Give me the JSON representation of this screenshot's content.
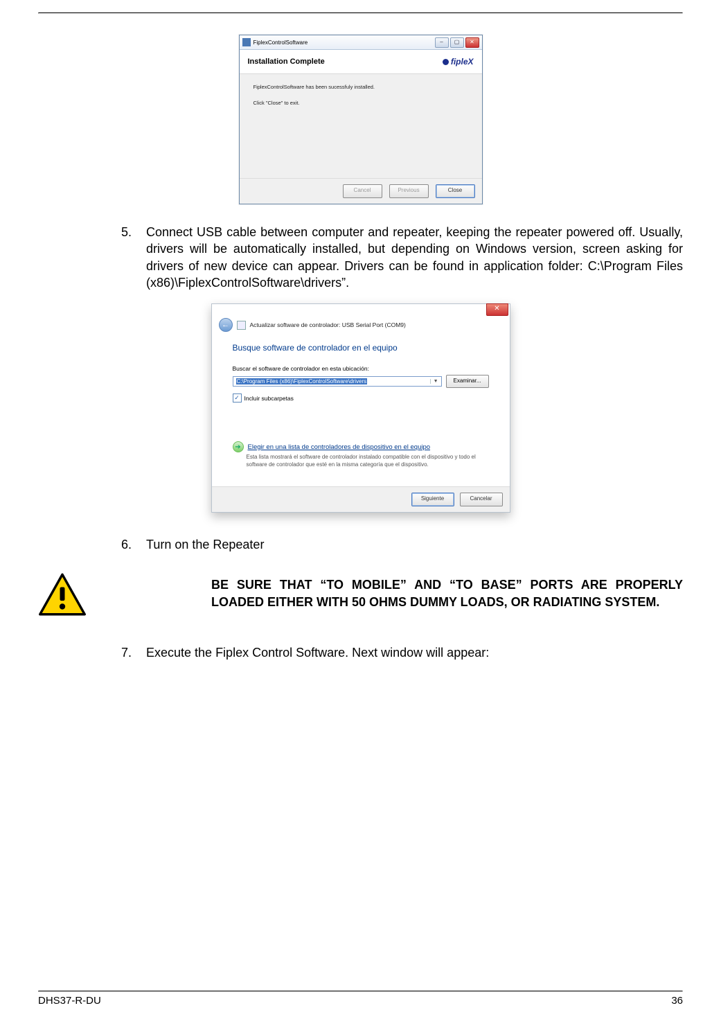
{
  "installer": {
    "window_title": "FiplexControlSoftware",
    "brand": "fipleX",
    "heading": "Installation Complete",
    "line1": "FiplexControlSoftware has been sucessfuly installed.",
    "line2": "Click \"Close\" to exit.",
    "buttons": {
      "cancel": "Cancel",
      "previous": "Previous",
      "close": "Close"
    }
  },
  "steps": {
    "s5_num": "5.",
    "s5_text": "Connect USB cable between computer and repeater, keeping the repeater powered off. Usually, drivers will be automatically installed, but depending on Windows version, screen asking for drivers of new device can appear. Drivers can be found in application folder: C:\\Program Files (x86)\\FiplexControlSoftware\\drivers”.",
    "s6_num": "6.",
    "s6_text": "Turn on the Repeater",
    "s7_num": "7.",
    "s7_text": "Execute the Fiplex Control Software. Next window will appear:"
  },
  "driver": {
    "crumb": "Actualizar software de controlador: USB Serial Port (COM9)",
    "heading": "Busque software de controlador en el equipo",
    "search_label": "Buscar el software de controlador en esta ubicación:",
    "path_value": "C:\\Program Files (x86)\\FiplexControlSoftware\\drivers",
    "browse": "Examinar...",
    "include_sub": "Incluir subcarpetas",
    "opt2_title": "Elegir en una lista de controladores de dispositivo en el equipo",
    "opt2_desc": "Esta lista mostrará el software de controlador instalado compatible con el dispositivo y todo el software de controlador que esté en la misma categoría que el dispositivo.",
    "next": "Siguiente",
    "cancel": "Cancelar"
  },
  "warning": "BE SURE THAT “TO MOBILE” AND “TO BASE” PORTS ARE PROPERLY LOADED EITHER WITH 50 OHMS DUMMY LOADS, OR RADIATING SYSTEM.",
  "footer": {
    "doc": "DHS37-R-DU",
    "page": "36"
  }
}
